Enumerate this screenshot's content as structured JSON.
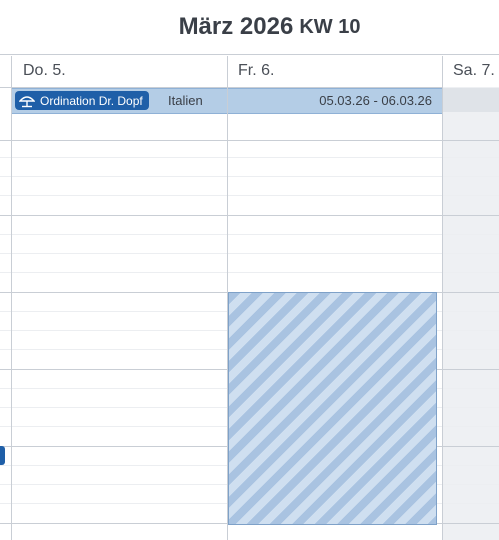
{
  "header": {
    "month": "März 2026",
    "week": "KW 10"
  },
  "days": [
    {
      "label": "Do. 5."
    },
    {
      "label": "Fr. 6."
    },
    {
      "label": "Sa. 7."
    }
  ],
  "event": {
    "title": "Ordination Dr. Dopf",
    "icon": "beach-umbrella-icon",
    "location": "Italien",
    "date_range": "05.03.26 - 06.03.26",
    "colors": {
      "badge": "#1f5fa8",
      "bar": "#b4cde6"
    }
  },
  "blocked_slot": {
    "day": "Fr. 6.",
    "pattern_colors": [
      "#a9c3e1",
      "#cfdff0"
    ]
  }
}
